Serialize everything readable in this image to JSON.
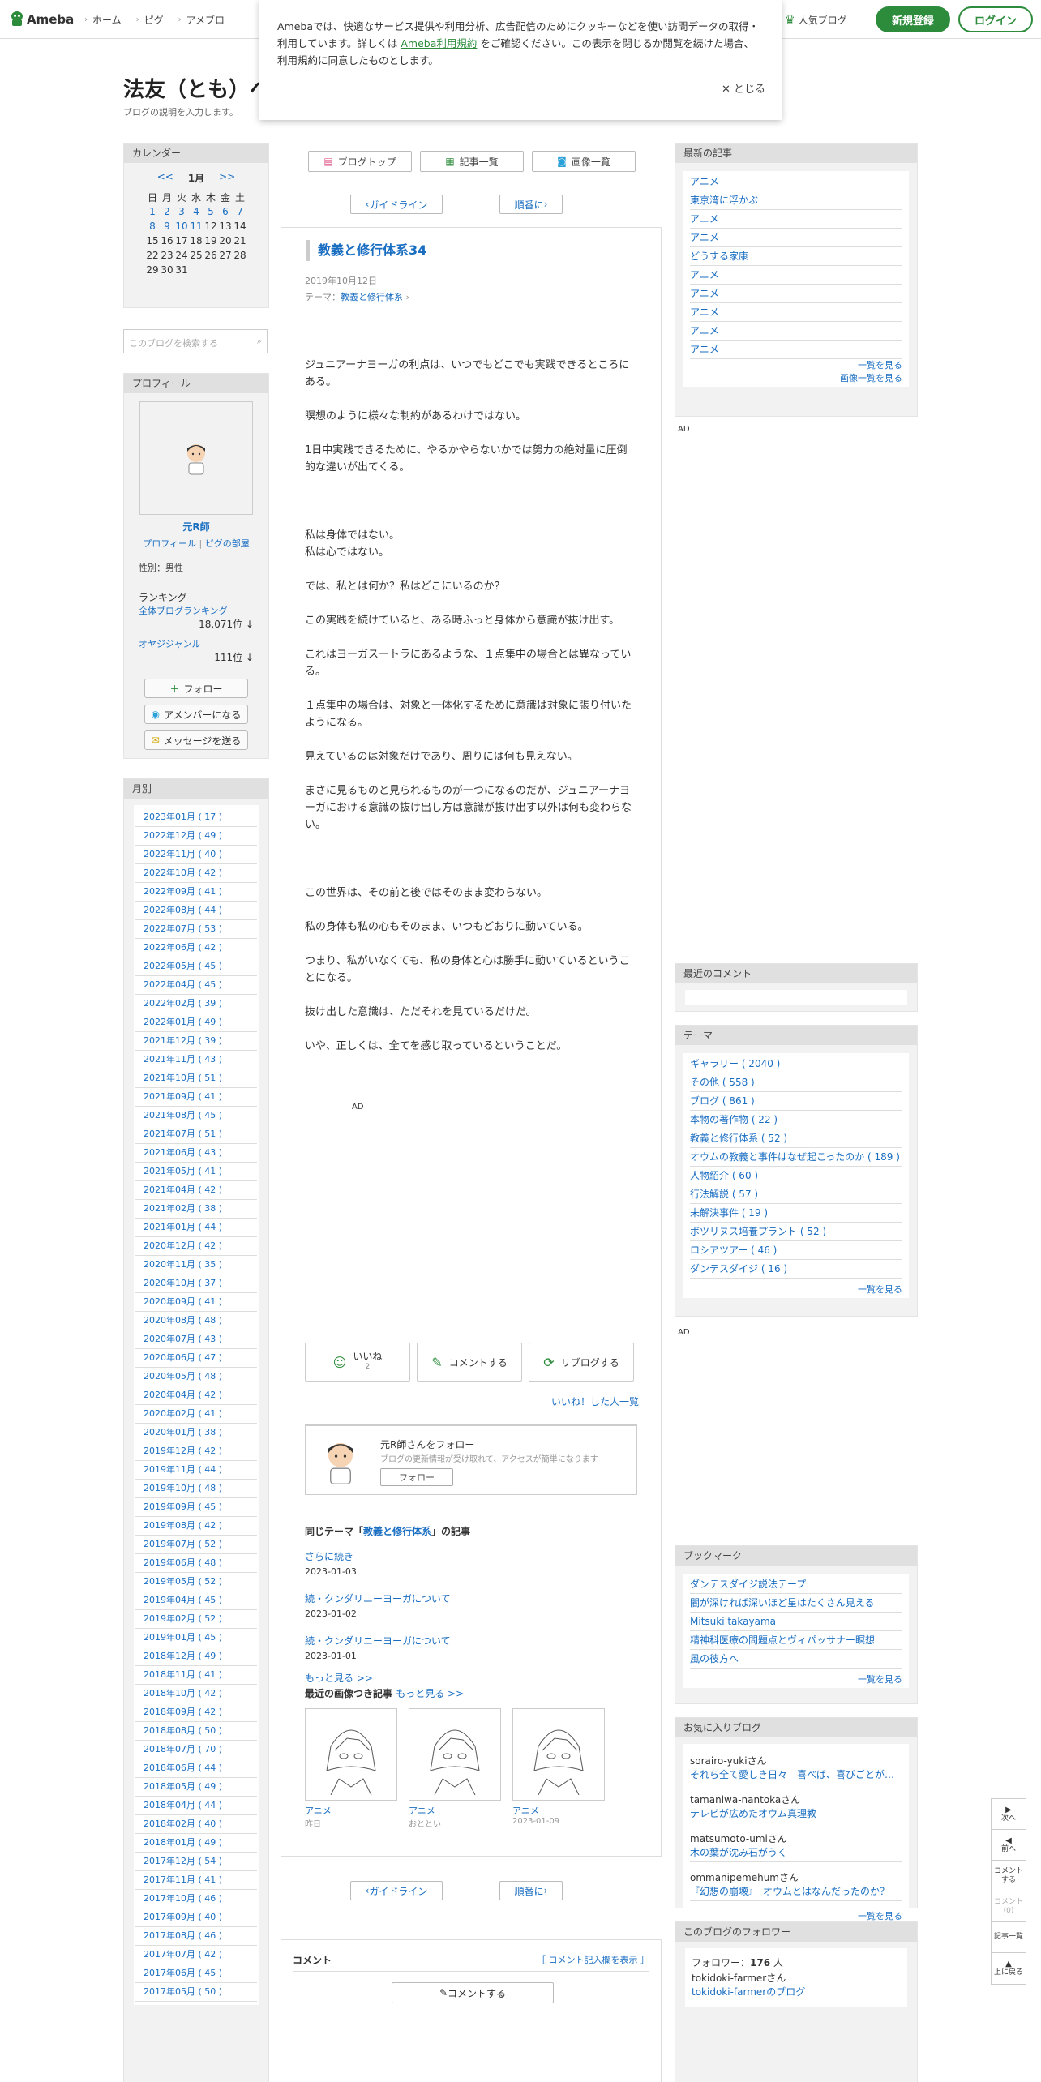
{
  "header": {
    "logo": "Ameba",
    "nav": [
      "ホーム",
      "ピグ",
      "アメブロ"
    ],
    "popular": "人気ブログ",
    "register": "新規登録",
    "login": "ログイン"
  },
  "cookie": {
    "text1": "Amebaでは、快適なサービス提供や利用分析、広告配信のためにクッキーなどを使い訪問データの取得・利用しています。詳しくは ",
    "link": "Ameba利用規約",
    "text2": " をご確認ください。この表示を閉じるか閲覧を続けた場合、利用規約に同意したものとします。",
    "close": "とじる"
  },
  "blog": {
    "title": "法友（とも）へ",
    "desc": "ブログの説明を入力します。"
  },
  "calendar": {
    "header": "カレンダー",
    "prev": "<<",
    "month": "1月",
    "next": ">>",
    "weekdays": [
      "日",
      "月",
      "火",
      "水",
      "木",
      "金",
      "土"
    ],
    "weeks": [
      [
        "1",
        "2",
        "3",
        "4",
        "5",
        "6",
        "7"
      ],
      [
        "8",
        "9",
        "10",
        "11",
        "12",
        "13",
        "14"
      ],
      [
        "15",
        "16",
        "17",
        "18",
        "19",
        "20",
        "21"
      ],
      [
        "22",
        "23",
        "24",
        "25",
        "26",
        "27",
        "28"
      ],
      [
        "29",
        "30",
        "31",
        "",
        "",
        "",
        ""
      ]
    ]
  },
  "search": {
    "placeholder": "このブログを検索する"
  },
  "profile": {
    "header": "プロフィール",
    "name": "元R師",
    "link1": "プロフィール",
    "sep": "|",
    "link2": "ピグの部屋",
    "gender": "性別：男性",
    "rank": "ランキング",
    "rank_all": "全体ブログランキング",
    "rank_all_num": "18,071位 ↓",
    "rank_genre": "オヤジジャンル",
    "rank_genre_num": "111位 ↓",
    "follow": "フォロー",
    "member": "アメンバーになる",
    "message": "メッセージを送る"
  },
  "monthly": {
    "header": "月別",
    "items": [
      "2023年01月 ( 17 )",
      "2022年12月 ( 49 )",
      "2022年11月 ( 40 )",
      "2022年10月 ( 42 )",
      "2022年09月 ( 41 )",
      "2022年08月 ( 44 )",
      "2022年07月 ( 53 )",
      "2022年06月 ( 42 )",
      "2022年05月 ( 45 )",
      "2022年04月 ( 45 )",
      "2022年02月 ( 39 )",
      "2022年01月 ( 49 )",
      "2021年12月 ( 39 )",
      "2021年11月 ( 43 )",
      "2021年10月 ( 51 )",
      "2021年09月 ( 41 )",
      "2021年08月 ( 45 )",
      "2021年07月 ( 51 )",
      "2021年06月 ( 43 )",
      "2021年05月 ( 41 )",
      "2021年04月 ( 42 )",
      "2021年02月 ( 38 )",
      "2021年01月 ( 44 )",
      "2020年12月 ( 42 )",
      "2020年11月 ( 35 )",
      "2020年10月 ( 37 )",
      "2020年09月 ( 41 )",
      "2020年08月 ( 48 )",
      "2020年07月 ( 43 )",
      "2020年06月 ( 47 )",
      "2020年05月 ( 48 )",
      "2020年04月 ( 42 )",
      "2020年02月 ( 41 )",
      "2020年01月 ( 38 )",
      "2019年12月 ( 42 )",
      "2019年11月 ( 44 )",
      "2019年10月 ( 48 )",
      "2019年09月 ( 45 )",
      "2019年08月 ( 42 )",
      "2019年07月 ( 52 )",
      "2019年06月 ( 48 )",
      "2019年05月 ( 52 )",
      "2019年04月 ( 45 )",
      "2019年02月 ( 52 )",
      "2019年01月 ( 45 )",
      "2018年12月 ( 49 )",
      "2018年11月 ( 41 )",
      "2018年10月 ( 42 )",
      "2018年09月 ( 42 )",
      "2018年08月 ( 50 )",
      "2018年07月 ( 70 )",
      "2018年06月 ( 44 )",
      "2018年05月 ( 49 )",
      "2018年04月 ( 44 )",
      "2018年02月 ( 40 )",
      "2018年01月 ( 49 )",
      "2017年12月 ( 54 )",
      "2017年11月 ( 41 )",
      "2017年10月 ( 46 )",
      "2017年09月 ( 40 )",
      "2017年08月 ( 46 )",
      "2017年07月 ( 42 )",
      "2017年06月 ( 45 )",
      "2017年05月 ( 50 )"
    ]
  },
  "toolbar": {
    "top": "ブログトップ",
    "list": "記事一覧",
    "images": "画像一覧",
    "guide": "ガイドライン",
    "order": "順番に"
  },
  "article": {
    "title": "教義と修行体系34",
    "date": "2019年10月12日",
    "theme_label": "テーマ：",
    "theme": "教義と修行体系",
    "paragraphs": [
      "ジュニアーナヨーガの利点は、いつでもどこでも実践できるところにある。",
      "瞑想のように様々な制約があるわけではない。",
      "1日中実践できるために、やるかやらないかでは努力の絶対量に圧倒的な違いが出てくる。",
      "",
      "私は身体ではない。\n私は心ではない。",
      "では、私とは何か？私はどこにいるのか？",
      "この実践を続けていると、ある時ふっと身体から意識が抜け出す。",
      "これはヨーガスートラにあるような、１点集中の場合とは異なっている。",
      "１点集中の場合は、対象と一体化するために意識は対象に張り付いたようになる。",
      "見えているのは対象だけであり、周りには何も見えない。",
      "まさに見るものと見られるものが一つになるのだが、ジュニアーナヨーガにおける意識の抜け出し方は意識が抜け出す以外は何も変わらない。",
      "",
      "この世界は、その前と後ではそのまま変わらない。",
      "私の身体も私の心もそのまま、いつもどおりに動いている。",
      "つまり、私がいなくても、私の身体と心は勝手に動いているということになる。",
      "抜け出した意識は、ただそれを見ているだけだ。",
      "いや、正しくは、全てを感じ取っているということだ。"
    ],
    "ad": "AD",
    "like": "いいね",
    "like_count": "2",
    "comment": "コメントする",
    "reblog": "リブログする",
    "liked_list": "いいね！した人一覧"
  },
  "followbox": {
    "title": "元R師さんをフォロー",
    "sub": "ブログの更新情報が受け取れて、アクセスが簡単になります",
    "btn": "フォロー"
  },
  "same": {
    "prefix": "同じテーマ「",
    "theme": "教義と修行体系",
    "suffix": "」の記事",
    "items": [
      {
        "t": "さらに続き",
        "d": "2023-01-03"
      },
      {
        "t": "続・クンダリニーヨーガについて",
        "d": "2023-01-02"
      },
      {
        "t": "続・クンダリニーヨーガについて",
        "d": "2023-01-01"
      }
    ],
    "more": "もっと見る >>"
  },
  "images": {
    "title": "最近の画像つき記事",
    "more": "もっと見る >>",
    "items": [
      {
        "t": "アニメ",
        "d": "昨日"
      },
      {
        "t": "アニメ",
        "d": "おととい"
      },
      {
        "t": "アニメ",
        "d": "2023-01-09"
      }
    ]
  },
  "comments": {
    "title": "コメント",
    "toggle": "［ コメント記入欄を表示 ］",
    "btn": "コメントする"
  },
  "recent": {
    "header": "最新の記事",
    "items": [
      "アニメ",
      "東京湾に浮かぶ",
      "アニメ",
      "アニメ",
      "どうする家康",
      "アニメ",
      "アニメ",
      "アニメ",
      "アニメ",
      "アニメ"
    ],
    "more1": "一覧を見る",
    "more2": "画像一覧を見る"
  },
  "ad_label": "AD",
  "recent_comments": {
    "header": "最近のコメント"
  },
  "themes": {
    "header": "テーマ",
    "items": [
      "ギャラリー ( 2040 )",
      "その他 ( 558 )",
      "ブログ ( 861 )",
      "本物の著作物 ( 22 )",
      "教義と修行体系 ( 52 )",
      "オウムの教義と事件はなぜ起こったのか ( 189 )",
      "人物紹介 ( 60 )",
      "行法解説 ( 57 )",
      "未解決事件 ( 19 )",
      "ボツリヌス培養プラント ( 52 )",
      "ロシアツアー ( 46 )",
      "ダンテスダイジ ( 16 )"
    ],
    "more": "一覧を見る"
  },
  "bookmarks": {
    "header": "ブックマーク",
    "items": [
      "ダンテスダイジ説法テープ",
      "闇が深ければ深いほど星はたくさん見える",
      "Mitsuki takayama",
      "精神科医療の問題点とヴィパッサナー瞑想",
      "風の彼方へ"
    ],
    "more": "一覧を見る"
  },
  "favblogs": {
    "header": "お気に入りブログ",
    "items": [
      {
        "n": "sorairo-yukiさん",
        "t": "それら全て愛しき日々　喜べば、喜びごとが…"
      },
      {
        "n": "tamaniwa-nantokaさん",
        "t": "テレビが広めたオウム真理教"
      },
      {
        "n": "matsumoto-umiさん",
        "t": "木の葉が沈み石がうく"
      },
      {
        "n": "ommanipemehumさん",
        "t": "『幻想の崩壊』　オウムとはなんだったのか？"
      }
    ],
    "more": "一覧を見る"
  },
  "followers": {
    "header": "このブログのフォロワー",
    "count_label": "フォロワー：",
    "count": "176",
    "unit": " 人",
    "user": "tokidoki-farmer",
    "user_suffix": "さん",
    "user_blog": "tokidoki-farmerのブログ"
  },
  "floatnav": {
    "next": "次へ",
    "prev": "前へ",
    "comment1": "コメント",
    "comment2": "する",
    "comment0": "コメント",
    "comment0n": "(0)",
    "list": "記事一覧",
    "top": "上に戻る"
  }
}
